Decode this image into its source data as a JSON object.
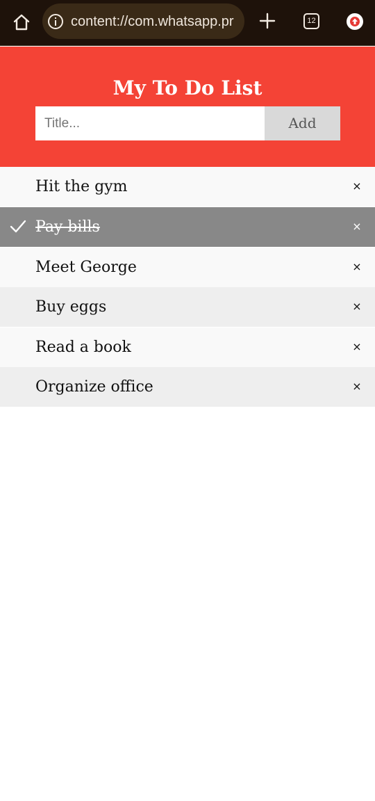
{
  "browser": {
    "url": "content://com.whatsapp.pr",
    "tab_count": "12",
    "icons": {
      "home": "home-icon",
      "info": "info-icon",
      "new_tab": "plus-icon",
      "tabs": "tab-switcher-icon",
      "update": "update-arrow-icon"
    }
  },
  "app": {
    "title": "My To Do List",
    "input_placeholder": "Title...",
    "add_label": "Add",
    "accent_color": "#f44336"
  },
  "todos": [
    {
      "label": "Hit the gym",
      "checked": false,
      "close": "×"
    },
    {
      "label": "Pay bills",
      "checked": true,
      "close": "×"
    },
    {
      "label": "Meet George",
      "checked": false,
      "close": "×"
    },
    {
      "label": "Buy eggs",
      "checked": false,
      "close": "×"
    },
    {
      "label": "Read a book",
      "checked": false,
      "close": "×"
    },
    {
      "label": "Organize office",
      "checked": false,
      "close": "×"
    }
  ]
}
